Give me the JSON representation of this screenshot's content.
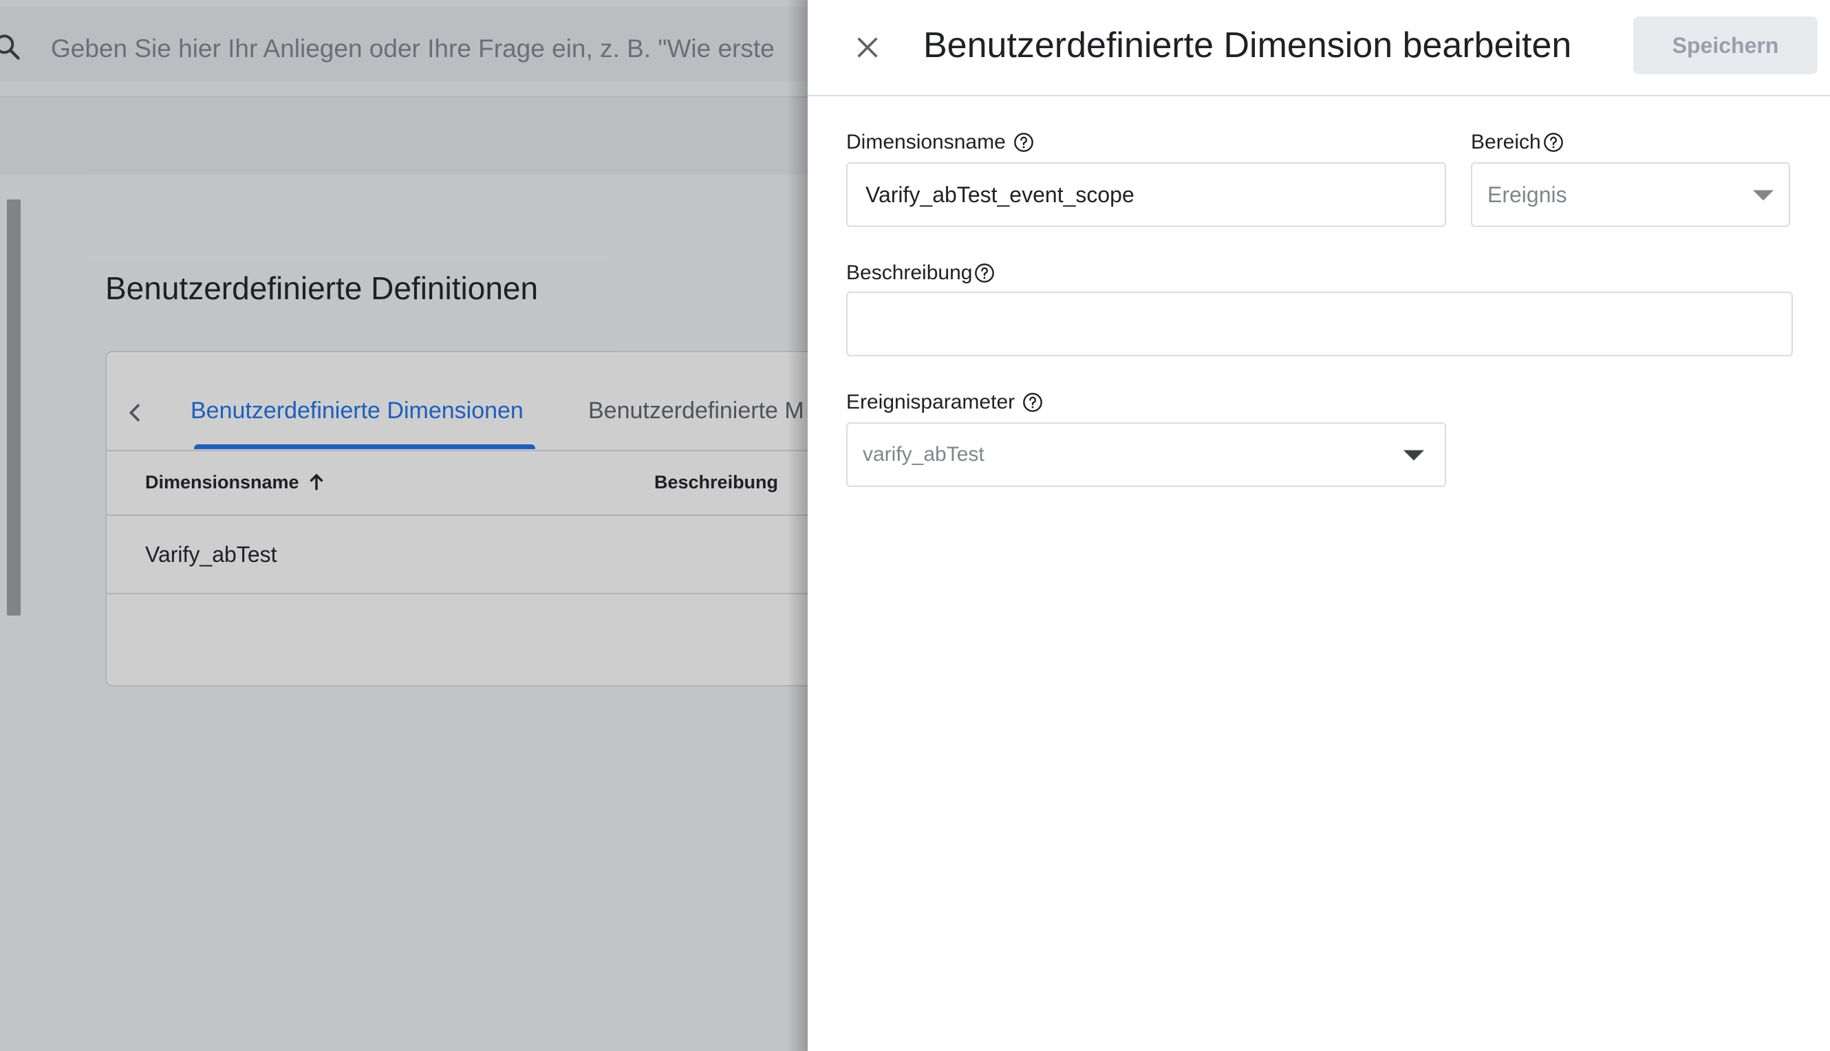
{
  "background": {
    "search": {
      "placeholder": "Geben Sie hier Ihr Anliegen oder Ihre Frage ein, z. B. \"Wie erste"
    },
    "page_title": "Benutzerdefinierte Definitionen",
    "tabs": [
      {
        "label": "Benutzerdefinierte Dimensionen",
        "active": true
      },
      {
        "label": "Benutzerdefinierte M",
        "active": false
      }
    ],
    "table": {
      "columns": [
        "Dimensionsname",
        "Beschreibung"
      ],
      "sort_column": "Dimensionsname",
      "sort_direction": "ascending",
      "rows": [
        {
          "name": "Varify_abTest",
          "description": ""
        }
      ]
    }
  },
  "panel": {
    "title": "Benutzerdefinierte Dimension bearbeiten",
    "save_label": "Speichern",
    "fields": {
      "dimension_name": {
        "label": "Dimensionsname",
        "value": "Varify_abTest_event_scope"
      },
      "scope": {
        "label": "Bereich",
        "value": "Ereignis"
      },
      "description": {
        "label": "Beschreibung",
        "value": ""
      },
      "event_parameter": {
        "label": "Ereignisparameter",
        "value": "varify_abTest"
      }
    }
  },
  "colors": {
    "accent": "#1a73e8",
    "text_primary": "#202124",
    "text_disabled": "#80868b",
    "border": "#dadce0",
    "save_disabled_bg": "#e8eaed"
  }
}
